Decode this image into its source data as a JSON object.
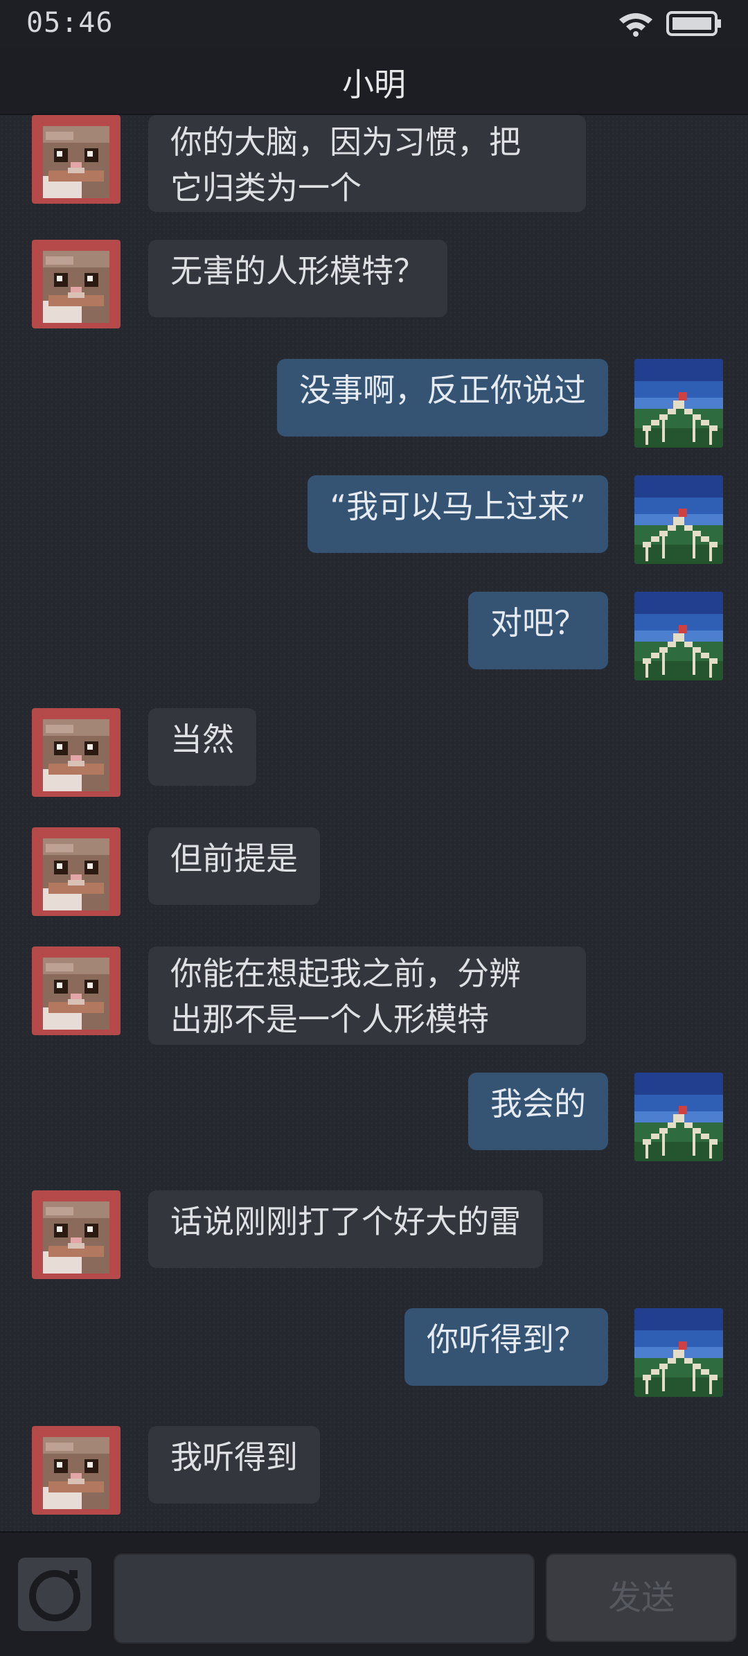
{
  "status_bar": {
    "time": "05:46"
  },
  "header": {
    "title": "小明"
  },
  "messages": [
    {
      "side": "in",
      "lines": [
        "你的大脑，因为习惯，把",
        "它归类为一个"
      ]
    },
    {
      "side": "in",
      "lines": [
        "无害的人形模特？"
      ]
    },
    {
      "side": "out",
      "lines": [
        "没事啊，反正你说过"
      ]
    },
    {
      "side": "out",
      "lines": [
        "“我可以马上过来”"
      ]
    },
    {
      "side": "out",
      "lines": [
        "对吧？"
      ]
    },
    {
      "side": "in",
      "lines": [
        "当然"
      ]
    },
    {
      "side": "in",
      "lines": [
        "但前提是"
      ]
    },
    {
      "side": "in",
      "lines": [
        "你能在想起我之前，分辨",
        "出那不是一个人形模特"
      ]
    },
    {
      "side": "out",
      "lines": [
        "我会的"
      ]
    },
    {
      "side": "in",
      "lines": [
        "话说刚刚打了个好大的雷"
      ]
    },
    {
      "side": "out",
      "lines": [
        "你听得到？"
      ]
    },
    {
      "side": "in",
      "lines": [
        "我听得到"
      ]
    }
  ],
  "input_bar": {
    "send_label": "发送",
    "input_value": ""
  },
  "colors": {
    "incoming_bubble": "#33363d",
    "outgoing_bubble": "#355474",
    "background": "#24272e"
  },
  "icons": {
    "contact_avatar": "cat-avatar-icon",
    "self_avatar": "landscape-avatar-icon",
    "camera": "camera-icon",
    "wifi": "wifi-icon",
    "battery": "battery-icon"
  }
}
